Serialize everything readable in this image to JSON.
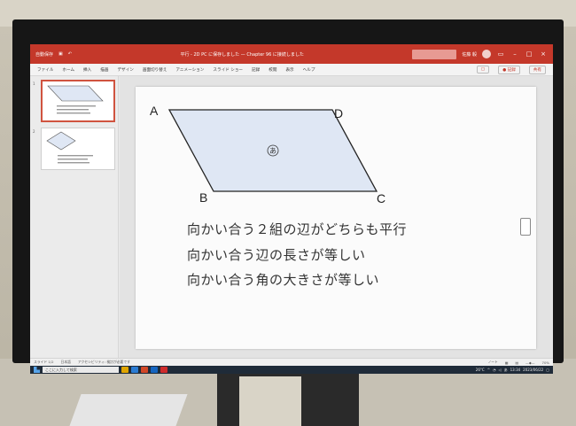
{
  "window": {
    "autosave": "自動保存",
    "doc_title": "平行 - 2D PC に保存しました — Chapter 96 に接続しました",
    "search_label": "検索",
    "user": "佐藤 毅"
  },
  "menu": {
    "items": [
      "ファイル",
      "ホーム",
      "挿入",
      "描画",
      "デザイン",
      "画面切り替え",
      "アニメーション",
      "スライド ショー",
      "記録",
      "校閲",
      "表示",
      "ヘルプ"
    ],
    "record_button": "● 記録",
    "share_button": "共有"
  },
  "thumbnails": [
    {
      "number": "1",
      "selected": true
    },
    {
      "number": "2",
      "selected": false
    }
  ],
  "slide": {
    "vertices": {
      "a": "A",
      "b": "B",
      "c": "C",
      "d": "D"
    },
    "shape_label": "あ",
    "properties": [
      "向かい合う２組の辺がどちらも平行",
      "向かい合う辺の長さが等しい",
      "向かい合う角の大きさが等しい"
    ],
    "fill_color": "#dfe7f4",
    "stroke_color": "#222222"
  },
  "statusbar": {
    "slide_counter": "スライド 1/2",
    "language": "日本語",
    "accessibility": "アクセシビリティ: 検討が必要です",
    "notes": "ノート",
    "zoom": "70%"
  },
  "taskbar": {
    "search_placeholder": "ここに入力して検索",
    "weather": "26°C",
    "ime": "あ",
    "time": "13:34",
    "date": "2023/06/22"
  },
  "colors": {
    "titlebar": "#c4382a",
    "taskbar": "#1f2b39"
  }
}
